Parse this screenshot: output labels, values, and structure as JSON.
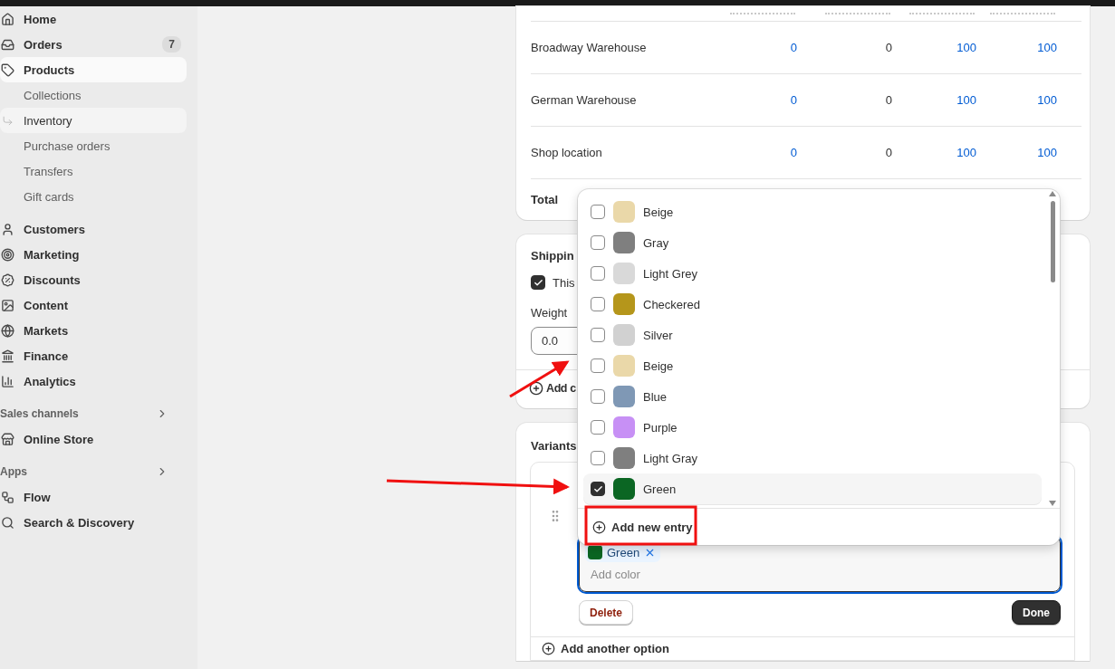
{
  "sidebar": {
    "items": [
      {
        "label": "Home",
        "kind": "main",
        "selected": false
      },
      {
        "label": "Orders",
        "kind": "main",
        "selected": false,
        "badge": "7"
      },
      {
        "label": "Products",
        "kind": "main",
        "selected": true
      },
      {
        "label": "Collections",
        "kind": "sub",
        "selected": false
      },
      {
        "label": "Inventory",
        "kind": "sub",
        "selected": true
      },
      {
        "label": "Purchase orders",
        "kind": "sub",
        "selected": false
      },
      {
        "label": "Transfers",
        "kind": "sub",
        "selected": false
      },
      {
        "label": "Gift cards",
        "kind": "sub",
        "selected": false
      },
      {
        "label": "Customers",
        "kind": "main",
        "selected": false
      },
      {
        "label": "Marketing",
        "kind": "main",
        "selected": false
      },
      {
        "label": "Discounts",
        "kind": "main",
        "selected": false
      },
      {
        "label": "Content",
        "kind": "main",
        "selected": false
      },
      {
        "label": "Markets",
        "kind": "main",
        "selected": false
      },
      {
        "label": "Finance",
        "kind": "main",
        "selected": false
      },
      {
        "label": "Analytics",
        "kind": "main",
        "selected": false
      },
      {
        "label": "Sales channels",
        "kind": "section"
      },
      {
        "label": "Online Store",
        "kind": "main",
        "selected": false
      },
      {
        "label": "Apps",
        "kind": "section"
      },
      {
        "label": "Flow",
        "kind": "main",
        "selected": false
      },
      {
        "label": "Search & Discovery",
        "kind": "main",
        "selected": false
      }
    ]
  },
  "inventory": {
    "rows": [
      {
        "location": "Broadway Warehouse",
        "cells": [
          {
            "text": "0",
            "link": true
          },
          {
            "text": "0",
            "link": false
          },
          {
            "text": "100",
            "link": true
          },
          {
            "text": "100",
            "link": true
          }
        ]
      },
      {
        "location": "German Warehouse",
        "cells": [
          {
            "text": "0",
            "link": true
          },
          {
            "text": "0",
            "link": false
          },
          {
            "text": "100",
            "link": true
          },
          {
            "text": "100",
            "link": true
          }
        ]
      },
      {
        "location": "Shop location",
        "cells": [
          {
            "text": "0",
            "link": true
          },
          {
            "text": "0",
            "link": false
          },
          {
            "text": "100",
            "link": true
          },
          {
            "text": "100",
            "link": true
          }
        ]
      }
    ],
    "total": "Total"
  },
  "shipping": {
    "title": "Shippin",
    "checkbox": {
      "label": "This",
      "checked": true
    },
    "weight": {
      "label": "Weight",
      "value": "0.0"
    },
    "add_link": "Add c"
  },
  "variants": {
    "title": "Variants",
    "values": [
      {
        "label": "Green",
        "color": "#0b6623"
      }
    ],
    "placeholder": "Add color",
    "delete": "Delete",
    "done": "Done",
    "add_option": "Add another option"
  },
  "dropdown": {
    "options": [
      {
        "label": "Beige",
        "color": "#ead8a9",
        "checked": false,
        "highlighted": false
      },
      {
        "label": "Gray",
        "color": "#7f7f7f",
        "checked": false,
        "highlighted": false
      },
      {
        "label": "Light Grey",
        "color": "#d9d9d9",
        "checked": false,
        "highlighted": false
      },
      {
        "label": "Checkered",
        "color": "#b5961b",
        "checked": false,
        "highlighted": false
      },
      {
        "label": "Silver",
        "color": "#d1d1d1",
        "checked": false,
        "highlighted": false
      },
      {
        "label": "Beige",
        "color": "#ead8a9",
        "checked": false,
        "highlighted": false
      },
      {
        "label": "Blue",
        "color": "#7f98b5",
        "checked": false,
        "highlighted": false
      },
      {
        "label": "Purple",
        "color": "#c790f5",
        "checked": false,
        "highlighted": false
      },
      {
        "label": "Light Gray",
        "color": "#7f7f7f",
        "checked": false,
        "highlighted": false
      },
      {
        "label": "Green",
        "color": "#0b6623",
        "checked": true,
        "highlighted": true
      }
    ],
    "add_entry": "Add new entry"
  }
}
